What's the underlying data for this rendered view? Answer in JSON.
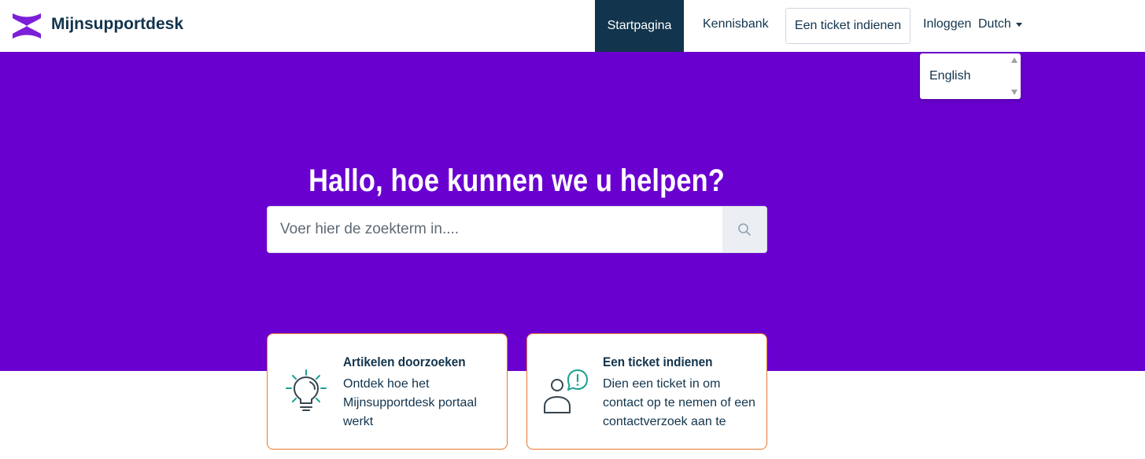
{
  "brand": {
    "name": "Mijnsupportdesk"
  },
  "nav": {
    "home": "Startpagina",
    "knowledge_base": "Kennisbank",
    "submit_ticket": "Een ticket indienen",
    "login": "Inloggen",
    "language": "Dutch"
  },
  "language_dropdown": {
    "options": [
      "English"
    ]
  },
  "hero": {
    "title": "Hallo, hoe kunnen we u helpen?",
    "search_placeholder": "Voer hier de zoekterm in...."
  },
  "cards": [
    {
      "title": "Artikelen doorzoeken",
      "description": "Ontdek hoe het Mijnsupportdesk portaal werkt",
      "icon": "lightbulb-icon"
    },
    {
      "title": "Een ticket indienen",
      "description": "Dien een ticket in om contact op te nemen of een contactverzoek aan te",
      "icon": "person-alert-icon"
    }
  ],
  "colors": {
    "hero_bg": "#6a00d0",
    "nav_active_bg": "#12344d",
    "card_border": "#e8772e",
    "icon_teal": "#1aa293",
    "logo_purple": "#7b1fd8"
  }
}
